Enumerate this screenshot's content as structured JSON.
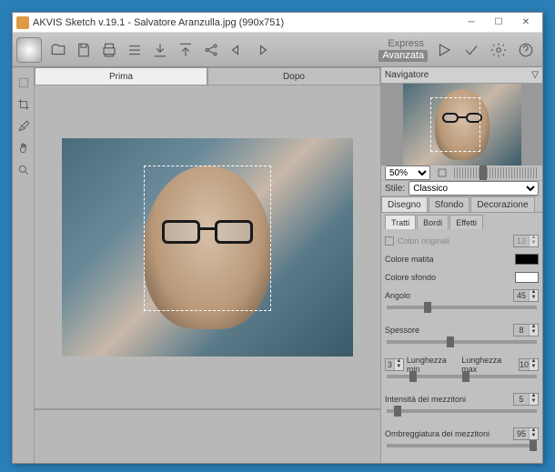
{
  "title": "AKVIS Sketch v.19.1 - Salvatore Aranzulla.jpg (990x751)",
  "modes": {
    "express": "Express",
    "advanced": "Avanzata"
  },
  "view_tabs": {
    "before": "Prima",
    "after": "Dopo"
  },
  "navigator": {
    "header": "Navigatore"
  },
  "zoom": {
    "value": "50%"
  },
  "style": {
    "label": "Stile:",
    "value": "Classico"
  },
  "panel_tabs": {
    "drawing": "Disegno",
    "background": "Sfondo",
    "decoration": "Decorazione"
  },
  "sub_tabs": {
    "strokes": "Tratti",
    "edges": "Bordi",
    "effects": "Effetti"
  },
  "params": {
    "original_colors": {
      "label": "Colori originali",
      "value": "13"
    },
    "pencil_color": "Colore matita",
    "bg_color": "Colore sfondo",
    "angle": {
      "label": "Angolo",
      "value": "45"
    },
    "thickness": {
      "label": "Spessore",
      "value": "8"
    },
    "min_length": {
      "label": "Lunghezza min",
      "value": "3"
    },
    "max_length": {
      "label": "Lunghezza max",
      "value": "10"
    },
    "midtone_intensity": {
      "label": "Intensità dei mezzitoni",
      "value": "5"
    },
    "midtone_hatching": {
      "label": "Ombreggiatura dei mezzitoni",
      "value": "95"
    }
  }
}
